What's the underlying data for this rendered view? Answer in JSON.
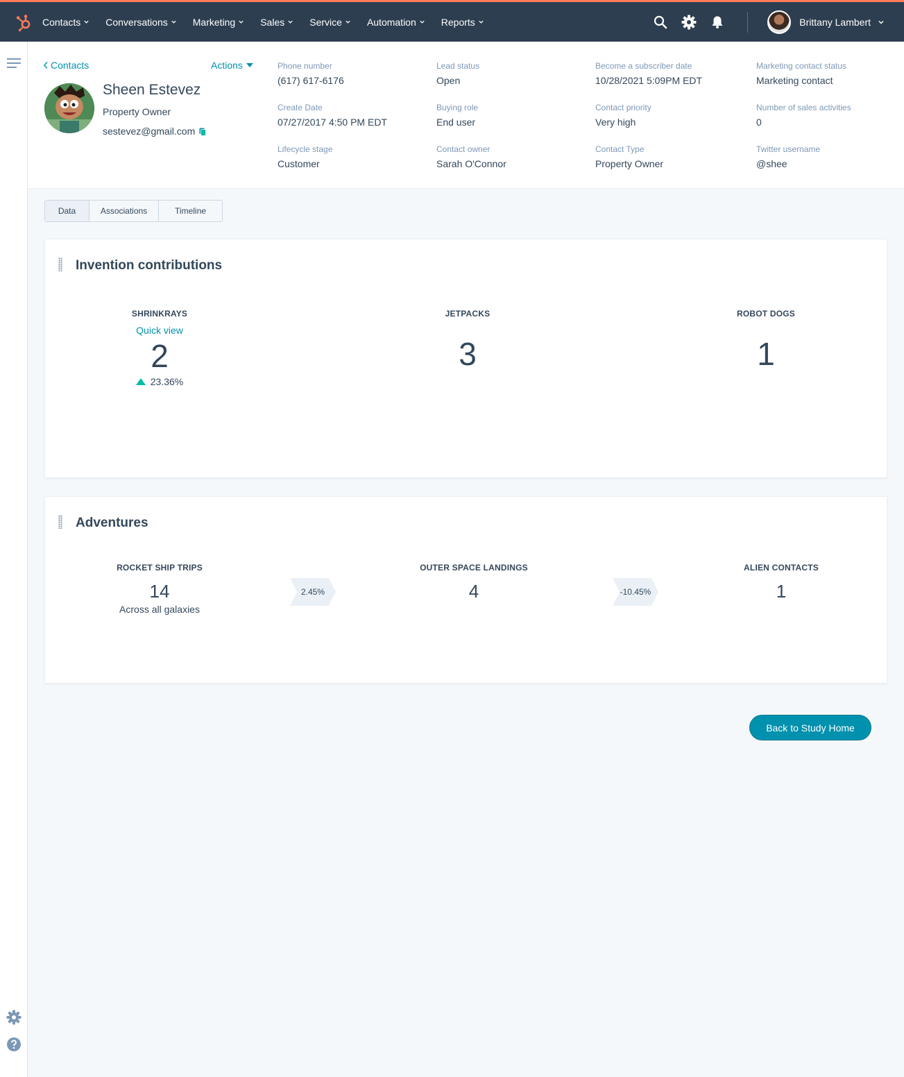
{
  "nav": {
    "items": [
      {
        "label": "Contacts"
      },
      {
        "label": "Conversations"
      },
      {
        "label": "Marketing"
      },
      {
        "label": "Sales"
      },
      {
        "label": "Service"
      },
      {
        "label": "Automation"
      },
      {
        "label": "Reports"
      }
    ],
    "user_name": "Brittany Lambert",
    "icons": [
      "search-icon",
      "gear-icon",
      "bell-icon"
    ]
  },
  "contact": {
    "back_label": "Contacts",
    "actions_label": "Actions",
    "name": "Sheen Estevez",
    "title": "Property Owner",
    "email": "sestevez@gmail.com"
  },
  "properties": [
    {
      "label": "Phone number",
      "value": "(617) 617-6176"
    },
    {
      "label": "Lead status",
      "value": "Open"
    },
    {
      "label": "Become a subscriber date",
      "value": "10/28/2021 5:09PM EDT"
    },
    {
      "label": "Marketing contact status",
      "value": "Marketing contact"
    },
    {
      "label": "Create Date",
      "value": "07/27/2017 4:50 PM EDT"
    },
    {
      "label": "Buying role",
      "value": "End user"
    },
    {
      "label": "Contact  priority",
      "value": "Very high"
    },
    {
      "label": "Number of sales activities",
      "value": "0"
    },
    {
      "label": "Lifecycle stage",
      "value": "Customer"
    },
    {
      "label": "Contact owner",
      "value": "Sarah O'Connor"
    },
    {
      "label": "Contact Type",
      "value": "Property Owner"
    },
    {
      "label": "Twitter username",
      "value": "@shee"
    }
  ],
  "tabs": [
    {
      "label": "Data",
      "active": true
    },
    {
      "label": "Associations",
      "active": false
    },
    {
      "label": "Timeline",
      "active": false
    }
  ],
  "inventions": {
    "title": "Invention contributions",
    "metrics": [
      {
        "label": "SHRINKRAYS",
        "link": "Quick view",
        "value": "2",
        "delta": "23.36%"
      },
      {
        "label": "JETPACKS",
        "value": "3"
      },
      {
        "label": "ROBOT DOGS",
        "value": "1"
      }
    ]
  },
  "adventures": {
    "title": "Adventures",
    "metrics": [
      {
        "label": "ROCKET SHIP TRIPS",
        "value": "14",
        "sub": "Across all galaxies"
      },
      {
        "label": "OUTER SPACE LANDINGS",
        "value": "4"
      },
      {
        "label": "ALIEN CONTACTS",
        "value": "1"
      }
    ],
    "conversions": [
      "2.45%",
      "-10.45%"
    ]
  },
  "back_button": "Back to Study Home",
  "colors": {
    "nav_bg": "#2d3e50",
    "accent_orange": "#ff7a59",
    "link": "#0091ae",
    "positive": "#00bda5"
  }
}
